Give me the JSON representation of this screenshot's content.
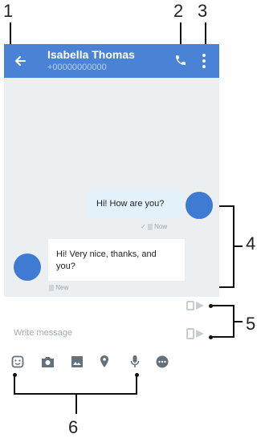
{
  "callouts": {
    "n1": "1",
    "n2": "2",
    "n3": "3",
    "n4": "4",
    "n5": "5",
    "n6": "6"
  },
  "header": {
    "name": "Isabella Thomas",
    "number": "+00000000000"
  },
  "messages": [
    {
      "text": "Hi! How are you?",
      "status": "Now",
      "direction": "outgoing"
    },
    {
      "text": "Hi! Very nice, thanks, and you?",
      "status": "New",
      "direction": "incoming"
    }
  ],
  "compose": {
    "placeholder": "Write message"
  },
  "attachments": [
    "sticker-icon",
    "camera-icon",
    "image-icon",
    "location-icon",
    "microphone-icon",
    "more-icon"
  ],
  "colors": {
    "appbar": "#4a82d6",
    "chat_bg": "#eceff1",
    "outgoing_bubble": "#e3f1fb",
    "incoming_bubble": "#ffffff",
    "avatar": "#3f7ad3"
  }
}
